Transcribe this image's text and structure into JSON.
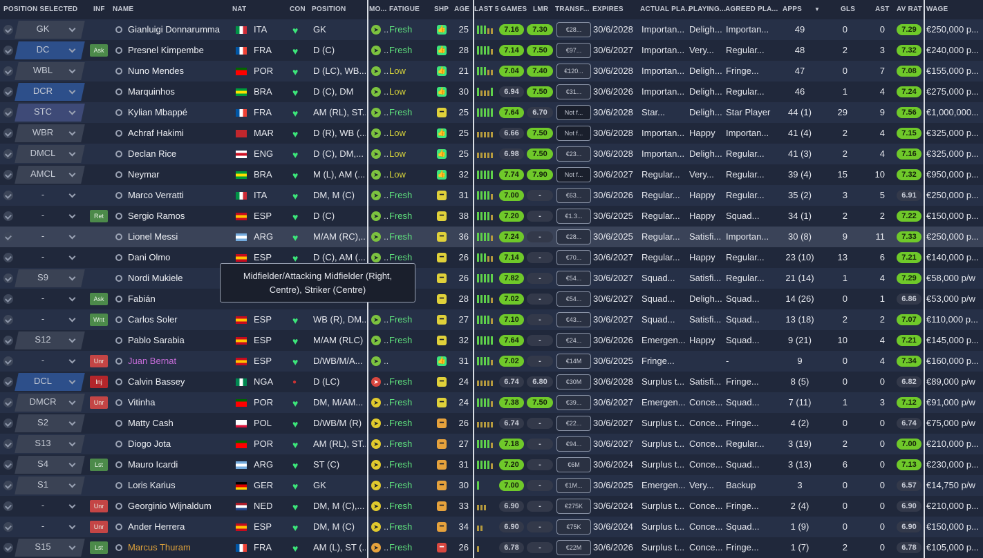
{
  "columns": [
    "Position Selected",
    "Inf",
    "Name",
    "Nat",
    "Con",
    "Position",
    "Mo...",
    "Fatigue",
    "Shp",
    "Age",
    "Last 5 Games",
    "LMR",
    "Transf...",
    "Expires",
    "Actual Pla...",
    "Playing...",
    "Agreed Pla...",
    "Apps",
    "Gls",
    "Ast",
    "Av Rat",
    "Wage"
  ],
  "tooltip": "Midfielder/Attacking Midfielder (Right, Centre), Striker (Centre)",
  "rows": [
    {
      "sel": "GK",
      "sc": "",
      "inf": "",
      "infc": "",
      "name": "Gianluigi Donnarumma",
      "nc": "",
      "fl": "ITA",
      "nat": "ITA",
      "con": "ok",
      "pos": "GK",
      "mo": "g",
      "mt": "",
      "fat": "Fresh",
      "fc": "f",
      "shp": "g",
      "age": "25",
      "bars": "gggoo",
      "r1": "7.16",
      "r1c": "rg",
      "r2": "7.30",
      "r2c": "rg",
      "tv": "€28...",
      "tvc": "",
      "exp": "30/6/2028",
      "ap": "Importan...",
      "pt": "Deligh...",
      "ag": "Importan...",
      "apps": "49",
      "gls": "0",
      "ast": "0",
      "avr": "7.29",
      "avc": "rg",
      "wage": "€250,000 p..."
    },
    {
      "sel": "DC",
      "sc": "blue",
      "inf": "Ask",
      "infc": "g",
      "name": "Presnel Kimpembe",
      "nc": "",
      "fl": "FRA",
      "nat": "FRA",
      "con": "ok",
      "pos": "D (C)",
      "mo": "g",
      "mt": "",
      "fat": "Fresh",
      "fc": "f",
      "shp": "g",
      "age": "28",
      "bars": "ggggo",
      "r1": "7.14",
      "r1c": "rg",
      "r2": "7.50",
      "r2c": "rg",
      "tv": "€97...",
      "tvc": "",
      "exp": "30/6/2027",
      "ap": "Importan...",
      "pt": "Very...",
      "ag": "Regular...",
      "apps": "48",
      "gls": "2",
      "ast": "3",
      "avr": "7.32",
      "avc": "rg",
      "wage": "€240,000 p..."
    },
    {
      "sel": "WBL",
      "sc": "",
      "inf": "",
      "infc": "",
      "name": "Nuno Mendes",
      "nc": "",
      "fl": "POR",
      "nat": "POR",
      "con": "ok",
      "pos": "D (LC), WB...",
      "mo": "g",
      "mt": "",
      "fat": "Low",
      "fc": "l",
      "shp": "g",
      "age": "21",
      "bars": "gggoo",
      "r1": "7.04",
      "r1c": "rg",
      "r2": "7.40",
      "r2c": "rg",
      "tv": "€120...",
      "tvc": "",
      "exp": "30/6/2028",
      "ap": "Importan...",
      "pt": "Deligh...",
      "ag": "Fringe...",
      "apps": "47",
      "gls": "0",
      "ast": "7",
      "avr": "7.08",
      "avc": "rg",
      "wage": "€155,000 p..."
    },
    {
      "sel": "DCR",
      "sc": "blue",
      "inf": "",
      "infc": "",
      "name": "Marquinhos",
      "nc": "",
      "fl": "BRA",
      "nat": "BRA",
      "con": "ok",
      "pos": "D (C), DM",
      "mo": "g",
      "mt": "",
      "fat": "Low",
      "fc": "l",
      "shp": "g",
      "age": "30",
      "bars": "gooog",
      "r1": "6.94",
      "r1c": "rd",
      "r2": "7.50",
      "r2c": "rg",
      "tv": "€31...",
      "tvc": "",
      "exp": "30/6/2026",
      "ap": "Importan...",
      "pt": "Deligh...",
      "ag": "Regular...",
      "apps": "46",
      "gls": "1",
      "ast": "4",
      "avr": "7.24",
      "avc": "rg",
      "wage": "€275,000 p..."
    },
    {
      "sel": "STC",
      "sc": "pur",
      "inf": "",
      "infc": "",
      "name": "Kylian Mbappé",
      "nc": "",
      "fl": "FRA",
      "nat": "FRA",
      "con": "ok",
      "pos": "AM (RL), ST...",
      "mo": "g",
      "mt": "",
      "fat": "Fresh",
      "fc": "f",
      "shp": "y",
      "age": "25",
      "bars": "ggggg",
      "r1": "7.64",
      "r1c": "rg",
      "r2": "6.70",
      "r2c": "rd",
      "tv": "Not f...",
      "tvc": "dk",
      "exp": "30/6/2028",
      "ap": "Star...",
      "pt": "Deligh...",
      "ag": "Star Player",
      "apps": "44 (1)",
      "gls": "29",
      "ast": "9",
      "avr": "7.56",
      "avc": "rg",
      "wage": "€1,000,000..."
    },
    {
      "sel": "WBR",
      "sc": "",
      "inf": "",
      "infc": "",
      "name": "Achraf Hakimi",
      "nc": "",
      "fl": "MAR",
      "nat": "MAR",
      "con": "ok",
      "pos": "D (R), WB (...",
      "mo": "g",
      "mt": "",
      "fat": "Low",
      "fc": "l",
      "shp": "g",
      "age": "25",
      "bars": "ooooo",
      "r1": "6.66",
      "r1c": "rd",
      "r2": "7.50",
      "r2c": "rg",
      "tv": "Not f...",
      "tvc": "dk",
      "exp": "30/6/2028",
      "ap": "Importan...",
      "pt": "Happy",
      "ag": "Importan...",
      "apps": "41 (4)",
      "gls": "2",
      "ast": "4",
      "avr": "7.15",
      "avc": "rg",
      "wage": "€325,000 p..."
    },
    {
      "sel": "DMCL",
      "sc": "",
      "inf": "",
      "infc": "",
      "name": "Declan Rice",
      "nc": "",
      "fl": "ENG",
      "nat": "ENG",
      "con": "ok",
      "pos": "D (C), DM,...",
      "mo": "g",
      "mt": "",
      "fat": "Low",
      "fc": "l",
      "shp": "g",
      "age": "25",
      "bars": "ooooo",
      "r1": "6.98",
      "r1c": "rd",
      "r2": "7.50",
      "r2c": "rg",
      "tv": "€23...",
      "tvc": "",
      "exp": "30/6/2028",
      "ap": "Importan...",
      "pt": "Deligh...",
      "ag": "Regular...",
      "apps": "41 (3)",
      "gls": "2",
      "ast": "4",
      "avr": "7.16",
      "avc": "rg",
      "wage": "€325,000 p..."
    },
    {
      "sel": "AMCL",
      "sc": "",
      "inf": "",
      "infc": "",
      "name": "Neymar",
      "nc": "",
      "fl": "BRA",
      "nat": "BRA",
      "con": "ok",
      "pos": "M (L), AM (...",
      "mo": "g",
      "mt": "",
      "fat": "Low",
      "fc": "l",
      "shp": "g",
      "age": "32",
      "bars": "ggggg",
      "r1": "7.74",
      "r1c": "rg",
      "r2": "7.90",
      "r2c": "rg",
      "tv": "Not f...",
      "tvc": "dk",
      "exp": "30/6/2027",
      "ap": "Regular...",
      "pt": "Very...",
      "ag": "Regular...",
      "apps": "39 (4)",
      "gls": "15",
      "ast": "10",
      "avr": "7.32",
      "avc": "rg",
      "wage": "€950,000 p..."
    },
    {
      "sel": "-",
      "sc": "empty",
      "inf": "",
      "infc": "",
      "name": "Marco Verratti",
      "nc": "",
      "fl": "ITA",
      "nat": "ITA",
      "con": "ok",
      "pos": "DM, M (C)",
      "mo": "g",
      "mt": "",
      "fat": "Fresh",
      "fc": "f",
      "shp": "y",
      "age": "31",
      "bars": "ggggo",
      "r1": "7.00",
      "r1c": "rg",
      "r2": "-",
      "r2c": "rd",
      "tv": "€63...",
      "tvc": "",
      "exp": "30/6/2026",
      "ap": "Regular...",
      "pt": "Happy",
      "ag": "Regular...",
      "apps": "35 (2)",
      "gls": "3",
      "ast": "5",
      "avr": "6.91",
      "avc": "rd",
      "wage": "€250,000 p..."
    },
    {
      "sel": "-",
      "sc": "empty",
      "inf": "Ret",
      "infc": "g",
      "name": "Sergio Ramos",
      "nc": "",
      "fl": "ESP",
      "nat": "ESP",
      "con": "ok",
      "pos": "D (C)",
      "mo": "g",
      "mt": "",
      "fat": "Fresh",
      "fc": "f",
      "shp": "y",
      "age": "38",
      "bars": "ggggo",
      "r1": "7.20",
      "r1c": "rg",
      "r2": "-",
      "r2c": "rd",
      "tv": "€1.3...",
      "tvc": "",
      "exp": "30/6/2025",
      "ap": "Regular...",
      "pt": "Happy",
      "ag": "Squad...",
      "apps": "34 (1)",
      "gls": "2",
      "ast": "2",
      "avr": "7.22",
      "avc": "rg",
      "wage": "€150,000 p..."
    },
    {
      "sel": "-",
      "sc": "empty",
      "inf": "",
      "infc": "",
      "name": "Lionel Messi",
      "nc": "",
      "fl": "ARG",
      "nat": "ARG",
      "con": "ok",
      "pos": "M/AM (RC),...",
      "mo": "g",
      "mt": "",
      "fat": "Fresh",
      "fc": "f",
      "shp": "y",
      "age": "36",
      "bars": "ggggo",
      "r1": "7.24",
      "r1c": "rg",
      "r2": "-",
      "r2c": "rd",
      "tv": "€28...",
      "tvc": "",
      "exp": "30/6/2025",
      "ap": "Regular...",
      "pt": "Satisfi...",
      "ag": "Importan...",
      "apps": "30 (8)",
      "gls": "9",
      "ast": "11",
      "avr": "7.33",
      "avc": "rg",
      "wage": "€250,000 p..."
    },
    {
      "sel": "-",
      "sc": "empty",
      "inf": "",
      "infc": "",
      "name": "Dani Olmo",
      "nc": "",
      "fl": "ESP",
      "nat": "ESP",
      "con": "ok",
      "pos": "D (C), AM (...",
      "mo": "g",
      "mt": "",
      "fat": "Fresh",
      "fc": "f",
      "shp": "y",
      "age": "26",
      "bars": "gggoo",
      "r1": "7.14",
      "r1c": "rg",
      "r2": "-",
      "r2c": "rd",
      "tv": "€70...",
      "tvc": "",
      "exp": "30/6/2027",
      "ap": "Regular...",
      "pt": "Happy",
      "ag": "Regular...",
      "apps": "23 (10)",
      "gls": "13",
      "ast": "6",
      "avr": "7.21",
      "avc": "rg",
      "wage": "€140,000 p..."
    },
    {
      "sel": "S9",
      "sc": "",
      "inf": "",
      "infc": "",
      "name": "Nordi Mukiele",
      "nc": "",
      "fl": "",
      "nat": "",
      "con": "",
      "pos": "",
      "mo": "",
      "mt": "",
      "fat": "",
      "fc": "f",
      "shp": "y",
      "age": "26",
      "bars": "ggggg",
      "r1": "7.82",
      "r1c": "rg",
      "r2": "-",
      "r2c": "rd",
      "tv": "€54...",
      "tvc": "",
      "exp": "30/6/2027",
      "ap": "Squad...",
      "pt": "Satisfi...",
      "ag": "Regular...",
      "apps": "21 (14)",
      "gls": "1",
      "ast": "4",
      "avr": "7.29",
      "avc": "rg",
      "wage": "€58,000 p/w"
    },
    {
      "sel": "-",
      "sc": "empty",
      "inf": "Ask",
      "infc": "g",
      "name": "Fabián",
      "nc": "",
      "fl": "",
      "nat": "",
      "con": "",
      "pos": "",
      "mo": "",
      "mt": "",
      "fat": "",
      "fc": "f",
      "shp": "y",
      "age": "28",
      "bars": "ggggo",
      "r1": "7.02",
      "r1c": "rg",
      "r2": "-",
      "r2c": "rd",
      "tv": "€54...",
      "tvc": "",
      "exp": "30/6/2027",
      "ap": "Squad...",
      "pt": "Deligh...",
      "ag": "Squad...",
      "apps": "14 (26)",
      "gls": "0",
      "ast": "1",
      "avr": "6.86",
      "avc": "rd",
      "wage": "€53,000 p/w"
    },
    {
      "sel": "-",
      "sc": "empty",
      "inf": "Wnt",
      "infc": "g",
      "name": "Carlos Soler",
      "nc": "",
      "fl": "ESP",
      "nat": "ESP",
      "con": "ok",
      "pos": "WB (R), DM...",
      "mo": "g",
      "mt": "",
      "fat": "Fresh",
      "fc": "f",
      "shp": "y",
      "age": "27",
      "bars": "ggggo",
      "r1": "7.10",
      "r1c": "rg",
      "r2": "-",
      "r2c": "rd",
      "tv": "€43...",
      "tvc": "",
      "exp": "30/6/2027",
      "ap": "Squad...",
      "pt": "Satisfi...",
      "ag": "Squad...",
      "apps": "13 (18)",
      "gls": "2",
      "ast": "2",
      "avr": "7.07",
      "avc": "rg",
      "wage": "€110,000 p..."
    },
    {
      "sel": "S12",
      "sc": "",
      "inf": "",
      "infc": "",
      "name": "Pablo Sarabia",
      "nc": "",
      "fl": "ESP",
      "nat": "ESP",
      "con": "ok",
      "pos": "M/AM (RLC)",
      "mo": "g",
      "mt": "",
      "fat": "Fresh",
      "fc": "f",
      "shp": "y",
      "age": "32",
      "bars": "ggggg",
      "r1": "7.64",
      "r1c": "rg",
      "r2": "-",
      "r2c": "rd",
      "tv": "€24...",
      "tvc": "",
      "exp": "30/6/2026",
      "ap": "Emergen...",
      "pt": "Happy",
      "ag": "Squad...",
      "apps": "9 (21)",
      "gls": "10",
      "ast": "4",
      "avr": "7.21",
      "avc": "rg",
      "wage": "€145,000 p..."
    },
    {
      "sel": "-",
      "sc": "empty",
      "inf": "Unr",
      "infc": "r",
      "name": "Juan Bernat",
      "nc": "pk",
      "fl": "ESP",
      "nat": "ESP",
      "con": "ok",
      "pos": "D/WB/M/A...",
      "mo": "g",
      "mt": "",
      "fat": "",
      "fc": "f",
      "shp": "g",
      "age": "31",
      "bars": "ggggo",
      "r1": "7.02",
      "r1c": "rg",
      "r2": "-",
      "r2c": "rd",
      "tv": "€14M",
      "tvc": "",
      "exp": "30/6/2025",
      "ap": "Fringe...",
      "pt": "",
      "ag": "-",
      "apps": "9",
      "gls": "0",
      "ast": "4",
      "avr": "7.34",
      "avc": "rg",
      "wage": "€160,000 p..."
    },
    {
      "sel": "DCL",
      "sc": "blue",
      "inf": "Inj",
      "infc": "dr",
      "name": "Calvin Bassey",
      "nc": "",
      "fl": "NGA",
      "nat": "NGA",
      "con": "inj",
      "pos": "D (LC)",
      "mo": "r",
      "mt": "",
      "fat": "Fresh",
      "fc": "f",
      "shp": "y",
      "age": "24",
      "bars": "ooooo",
      "r1": "6.74",
      "r1c": "rd",
      "r2": "6.80",
      "r2c": "rd",
      "tv": "€30M",
      "tvc": "",
      "exp": "30/6/2028",
      "ap": "Surplus t...",
      "pt": "Satisfi...",
      "ag": "Fringe...",
      "apps": "8 (5)",
      "gls": "0",
      "ast": "0",
      "avr": "6.82",
      "avc": "rd",
      "wage": "€89,000 p/w"
    },
    {
      "sel": "DMCR",
      "sc": "",
      "inf": "Unr",
      "infc": "r",
      "name": "Vitinha",
      "nc": "",
      "fl": "POR",
      "nat": "POR",
      "con": "ok",
      "pos": "DM, M/AM...",
      "mo": "y",
      "mt": "",
      "fat": "Fresh",
      "fc": "f",
      "shp": "y",
      "age": "24",
      "bars": "ggggo",
      "r1": "7.38",
      "r1c": "rg",
      "r2": "7.50",
      "r2c": "rg",
      "tv": "€39...",
      "tvc": "",
      "exp": "30/6/2027",
      "ap": "Emergen...",
      "pt": "Conce...",
      "ag": "Squad...",
      "apps": "7 (11)",
      "gls": "1",
      "ast": "3",
      "avr": "7.12",
      "avc": "rg",
      "wage": "€91,000 p/w"
    },
    {
      "sel": "S2",
      "sc": "",
      "inf": "",
      "infc": "",
      "name": "Matty Cash",
      "nc": "",
      "fl": "POL",
      "nat": "POL",
      "con": "ok",
      "pos": "D/WB/M (R)",
      "mo": "y",
      "mt": "",
      "fat": "Fresh",
      "fc": "f",
      "shp": "o",
      "age": "26",
      "bars": "ooooo",
      "r1": "6.74",
      "r1c": "rd",
      "r2": "-",
      "r2c": "rd",
      "tv": "€22...",
      "tvc": "",
      "exp": "30/6/2027",
      "ap": "Surplus t...",
      "pt": "Conce...",
      "ag": "Fringe...",
      "apps": "4 (2)",
      "gls": "0",
      "ast": "0",
      "avr": "6.74",
      "avc": "rd",
      "wage": "€75,000 p/w"
    },
    {
      "sel": "S13",
      "sc": "",
      "inf": "",
      "infc": "",
      "name": "Diogo Jota",
      "nc": "",
      "fl": "POR",
      "nat": "POR",
      "con": "ok",
      "pos": "AM (RL), ST...",
      "mo": "y",
      "mt": "",
      "fat": "Fresh",
      "fc": "f",
      "shp": "o",
      "age": "27",
      "bars": "ggggo",
      "r1": "7.18",
      "r1c": "rg",
      "r2": "-",
      "r2c": "rd",
      "tv": "€94...",
      "tvc": "",
      "exp": "30/6/2027",
      "ap": "Surplus t...",
      "pt": "Conce...",
      "ag": "Regular...",
      "apps": "3 (19)",
      "gls": "2",
      "ast": "0",
      "avr": "7.00",
      "avc": "rg",
      "wage": "€210,000 p..."
    },
    {
      "sel": "S4",
      "sc": "",
      "inf": "Lst",
      "infc": "g",
      "name": "Mauro Icardi",
      "nc": "",
      "fl": "ARG",
      "nat": "ARG",
      "con": "ok",
      "pos": "ST (C)",
      "mo": "y",
      "mt": "",
      "fat": "Fresh",
      "fc": "f",
      "shp": "o",
      "age": "31",
      "bars": "ggggo",
      "r1": "7.20",
      "r1c": "rg",
      "r2": "-",
      "r2c": "rd",
      "tv": "€6M",
      "tvc": "",
      "exp": "30/6/2024",
      "ap": "Surplus t...",
      "pt": "Conce...",
      "ag": "Squad...",
      "apps": "3 (13)",
      "gls": "6",
      "ast": "0",
      "avr": "7.13",
      "avc": "rg",
      "wage": "€230,000 p..."
    },
    {
      "sel": "S1",
      "sc": "",
      "inf": "",
      "infc": "",
      "name": "Loris Karius",
      "nc": "",
      "fl": "GER",
      "nat": "GER",
      "con": "ok",
      "pos": "GK",
      "mo": "y",
      "mt": "",
      "fat": "Fresh",
      "fc": "f",
      "shp": "o",
      "age": "30",
      "bars": "g",
      "r1": "7.00",
      "r1c": "rg",
      "r2": "-",
      "r2c": "rd",
      "tv": "€1M...",
      "tvc": "",
      "exp": "30/6/2025",
      "ap": "Emergen...",
      "pt": "Very...",
      "ag": "Backup",
      "apps": "3",
      "gls": "0",
      "ast": "0",
      "avr": "6.57",
      "avc": "rd",
      "wage": "€14,750 p/w"
    },
    {
      "sel": "-",
      "sc": "empty",
      "inf": "Unr",
      "infc": "r",
      "name": "Georginio Wijnaldum",
      "nc": "",
      "fl": "NED",
      "nat": "NED",
      "con": "ok",
      "pos": "DM, M (C),...",
      "mo": "y",
      "mt": "",
      "fat": "Fresh",
      "fc": "f",
      "shp": "o",
      "age": "33",
      "bars": "ooo",
      "r1": "6.90",
      "r1c": "rd",
      "r2": "-",
      "r2c": "rd",
      "tv": "€275K",
      "tvc": "",
      "exp": "30/6/2024",
      "ap": "Surplus t...",
      "pt": "Conce...",
      "ag": "Fringe...",
      "apps": "2 (4)",
      "gls": "0",
      "ast": "0",
      "avr": "6.90",
      "avc": "rd",
      "wage": "€210,000 p..."
    },
    {
      "sel": "-",
      "sc": "empty",
      "inf": "Unr",
      "infc": "r",
      "name": "Ander Herrera",
      "nc": "",
      "fl": "ESP",
      "nat": "ESP",
      "con": "ok",
      "pos": "DM, M (C)",
      "mo": "y",
      "mt": "",
      "fat": "Fresh",
      "fc": "f",
      "shp": "o",
      "age": "34",
      "bars": "oo",
      "r1": "6.90",
      "r1c": "rd",
      "r2": "-",
      "r2c": "rd",
      "tv": "€75K",
      "tvc": "",
      "exp": "30/6/2024",
      "ap": "Surplus t...",
      "pt": "Conce...",
      "ag": "Squad...",
      "apps": "1 (9)",
      "gls": "0",
      "ast": "0",
      "avr": "6.90",
      "avc": "rd",
      "wage": "€150,000 p..."
    },
    {
      "sel": "S15",
      "sc": "",
      "inf": "Lst",
      "infc": "g",
      "name": "Marcus Thuram",
      "nc": "or",
      "fl": "FRA",
      "nat": "FRA",
      "con": "ok",
      "pos": "AM (L), ST (...",
      "mo": "o",
      "mt": "",
      "fat": "Fresh",
      "fc": "f",
      "shp": "r",
      "age": "26",
      "bars": "o",
      "r1": "6.78",
      "r1c": "rd",
      "r2": "-",
      "r2c": "rd",
      "tv": "€22M",
      "tvc": "",
      "exp": "30/6/2026",
      "ap": "Surplus t...",
      "pt": "Conce...",
      "ag": "Fringe...",
      "apps": "1 (7)",
      "gls": "2",
      "ast": "0",
      "avr": "6.78",
      "avc": "rd",
      "wage": "€105,000 p..."
    }
  ]
}
